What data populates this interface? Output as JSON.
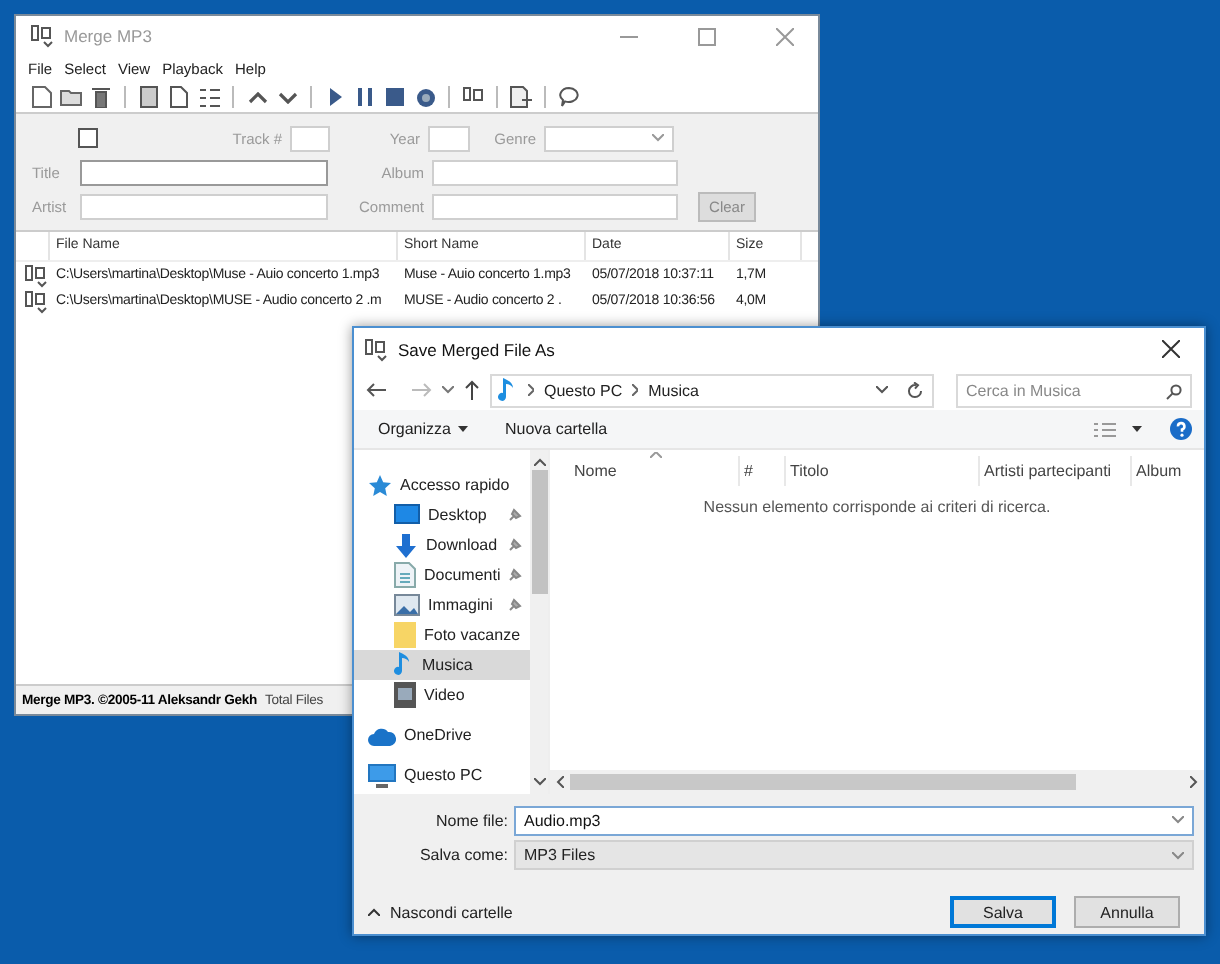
{
  "main_window": {
    "title": "Merge MP3",
    "menu": [
      "File",
      "Select",
      "View",
      "Playback",
      "Help"
    ],
    "tags": {
      "checkbox": {
        "checked": false
      },
      "track_label": "Track #",
      "year_label": "Year",
      "genre_label": "Genre",
      "title_label": "Title",
      "artist_label": "Artist",
      "album_label": "Album",
      "comment_label": "Comment",
      "clear_button": {
        "label": "Clear",
        "disabled": true
      }
    },
    "files": {
      "columns": [
        "File Name",
        "Short Name",
        "Date",
        "Size"
      ],
      "rows": [
        {
          "file_name": "C:\\Users\\martina\\Desktop\\Muse - Auio concerto 1.mp3",
          "short_name": "Muse - Auio concerto 1.mp3",
          "date": "05/07/2018 10:37:11",
          "size": "1,7M"
        },
        {
          "file_name": "C:\\Users\\martina\\Desktop\\MUSE - Audio concerto 2 .m",
          "short_name": "MUSE - Audio concerto 2 .",
          "date": "05/07/2018 10:36:56",
          "size": "4,0M"
        }
      ]
    },
    "status_bar": {
      "copyright": "Merge MP3. ©2005-11 Aleksandr Gekh",
      "total": "Total Files"
    }
  },
  "dialog": {
    "title": "Save Merged File As",
    "breadcrumb": [
      "Questo PC",
      "Musica"
    ],
    "search": {
      "placeholder": "Cerca in Musica"
    },
    "commands": {
      "organize": "Organizza",
      "new_folder": "Nuova cartella"
    },
    "nav": [
      {
        "label": "Accesso rapido",
        "kind": "star",
        "pinned": false,
        "selected": false,
        "children": [
          {
            "label": "Desktop",
            "kind": "desktop",
            "pinned": true,
            "selected": false
          },
          {
            "label": "Download",
            "kind": "download",
            "pinned": true,
            "selected": false
          },
          {
            "label": "Documenti",
            "kind": "documents",
            "pinned": true,
            "selected": false
          },
          {
            "label": "Immagini",
            "kind": "pictures",
            "pinned": true,
            "selected": false
          },
          {
            "label": "Foto vacanze",
            "kind": "folder",
            "pinned": false,
            "selected": false
          },
          {
            "label": "Musica",
            "kind": "music",
            "pinned": false,
            "selected": true
          },
          {
            "label": "Video",
            "kind": "video",
            "pinned": false,
            "selected": false
          }
        ]
      },
      {
        "label": "OneDrive",
        "kind": "cloud",
        "pinned": false,
        "selected": false
      },
      {
        "label": "Questo PC",
        "kind": "pc",
        "pinned": false,
        "selected": false
      }
    ],
    "columns": [
      "Nome",
      "#",
      "Titolo",
      "Artisti partecipanti",
      "Album"
    ],
    "empty_message": "Nessun elemento corrisponde ai criteri di ricerca.",
    "file_name": {
      "label": "Nome file:",
      "value": "Audio.mp3"
    },
    "save_as": {
      "label": "Salva come:",
      "value": "MP3 Files"
    },
    "hide_folders": "Nascondi cartelle",
    "buttons": [
      {
        "label": "Salva",
        "default": true
      },
      {
        "label": "Annulla",
        "default": false
      }
    ]
  }
}
